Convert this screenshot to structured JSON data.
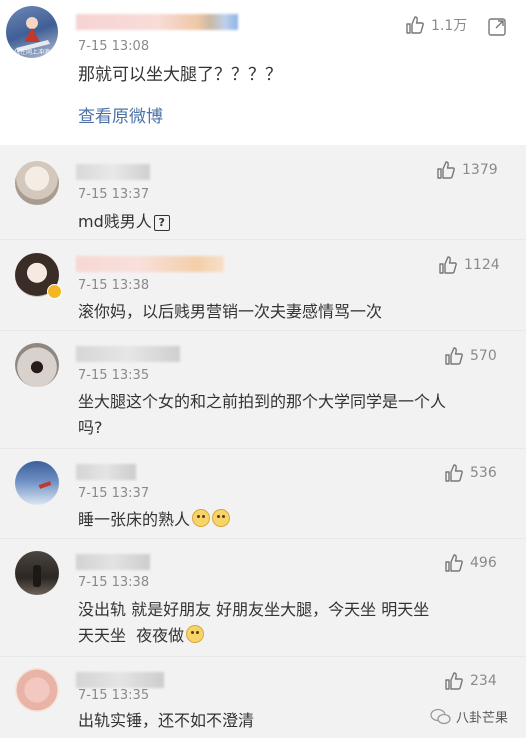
{
  "top_comment": {
    "time": "7-15 13:08",
    "text": "那就可以坐大腿了？？？？",
    "likes": "1.1万",
    "view_original": "查看原微博",
    "avatar_caption": "坑在网上冲浪"
  },
  "replies": [
    {
      "time": "7-15 13:37",
      "text": "md贱男人",
      "likes": "1379",
      "suffix": "?"
    },
    {
      "time": "7-15 13:38",
      "text": "滚你妈，以后贱男营销一次夫妻感情骂一次",
      "likes": "1124"
    },
    {
      "time": "7-15 13:35",
      "text_line1": "坐大腿这个女的和之前拍到的那个大学同学是一个人",
      "text_line2": "吗?",
      "likes": "570"
    },
    {
      "time": "7-15 13:37",
      "text": "睡一张床的熟人",
      "likes": "536"
    },
    {
      "time": "7-15 13:38",
      "text_line1": "没出轨 就是好朋友 好朋友坐大腿，今天坐 明天坐",
      "text_line2": "天天坐  夜夜做",
      "likes": "496"
    },
    {
      "time": "7-15 13:35",
      "text": "出轨实锤，还不如不澄清",
      "likes": "234"
    }
  ],
  "watermark": "八卦芒果",
  "icons": {
    "like": "thumbs-up-icon",
    "share": "share-icon"
  }
}
